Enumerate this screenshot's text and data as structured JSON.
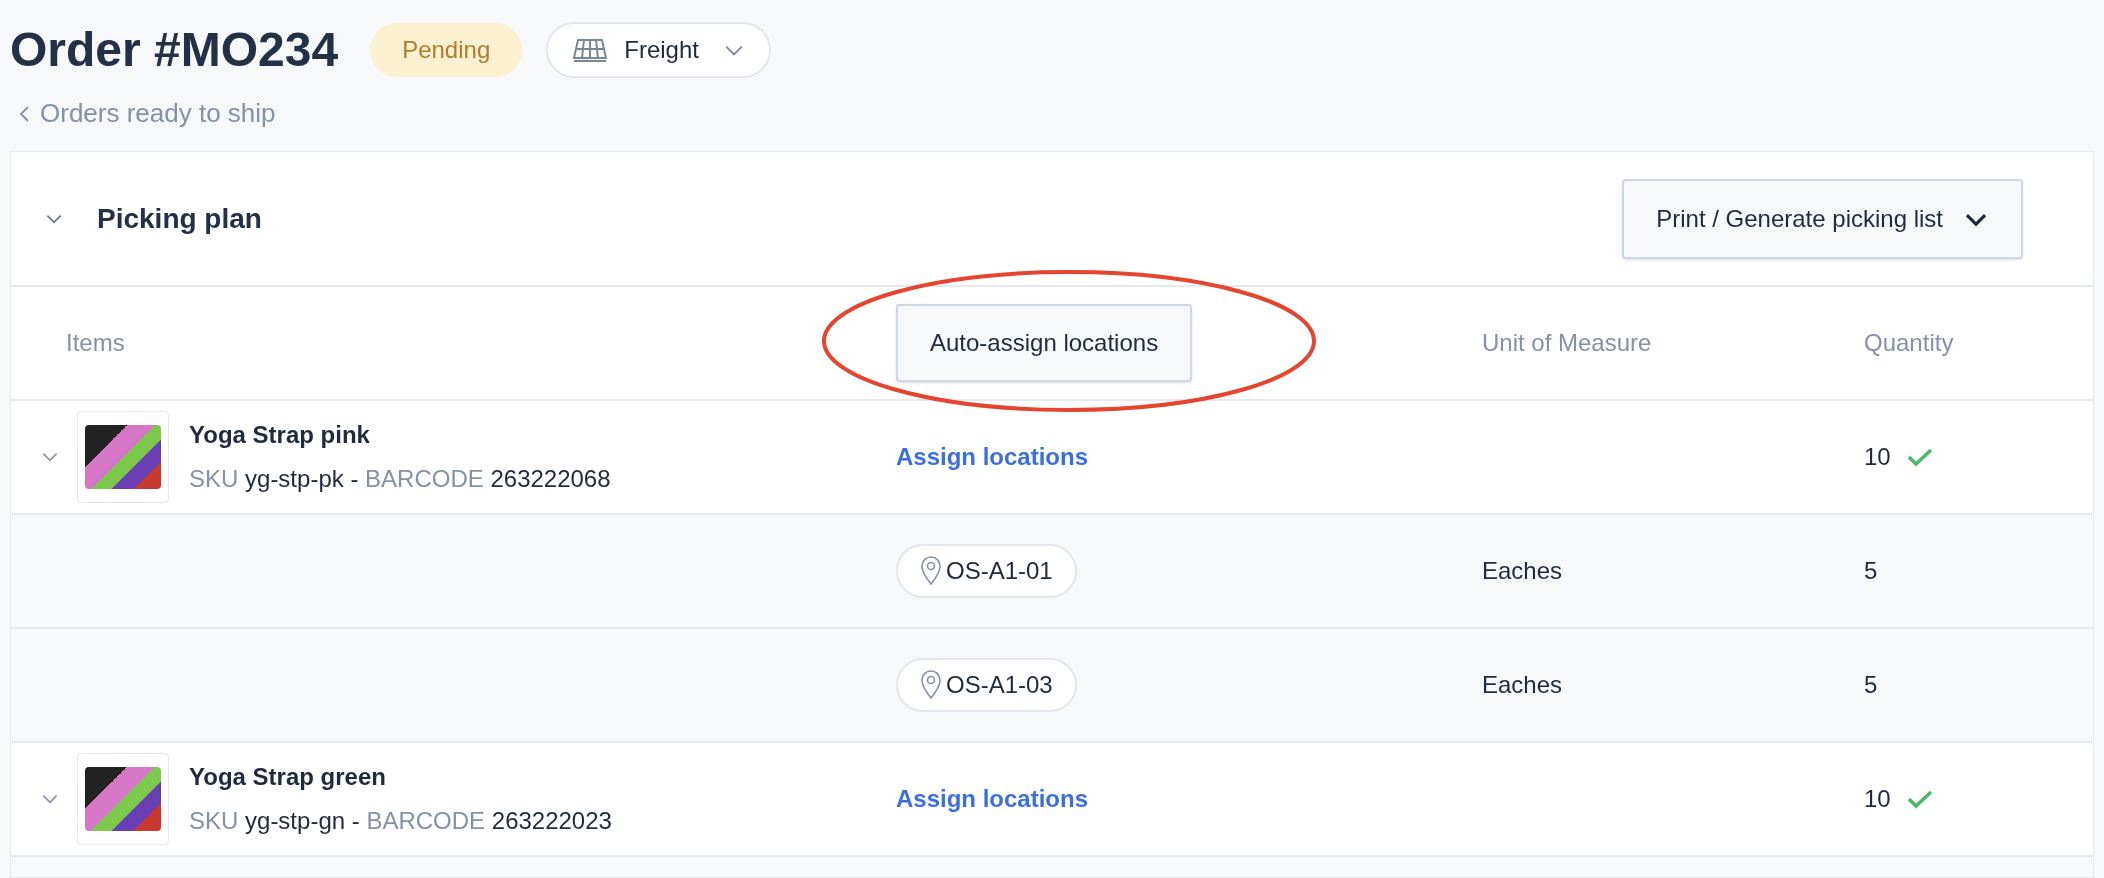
{
  "order": {
    "title": "Order #MO234",
    "status": {
      "label": "Pending",
      "kind": "pending"
    },
    "shipping": {
      "label": "Freight"
    },
    "breadcrumb": "Orders ready to ship"
  },
  "section": {
    "title": "Picking plan",
    "expanded": true,
    "action_button": "Print / Generate picking list"
  },
  "table": {
    "columns": [
      {
        "kind": "text",
        "label": "Items"
      },
      {
        "kind": "button",
        "label": "Auto-assign locations"
      },
      {
        "kind": "text",
        "label": "Unit of Measure"
      },
      {
        "kind": "text",
        "label": "Quantity"
      }
    ],
    "rows": [
      {
        "kind": "product",
        "expanded": true,
        "name": "Yoga Strap pink",
        "sku_label": "SKU",
        "sku": "yg-stp-pk",
        "separator": "-",
        "barcode_label": "BARCODE",
        "barcode": "263222068",
        "link": "Assign locations",
        "quantity": "10",
        "complete": true
      },
      {
        "kind": "location",
        "location": "OS-A1-01",
        "unit": "Eaches",
        "quantity": "5"
      },
      {
        "kind": "location",
        "location": "OS-A1-03",
        "unit": "Eaches",
        "quantity": "5"
      },
      {
        "kind": "product",
        "expanded": true,
        "name": "Yoga Strap green",
        "sku_label": "SKU",
        "sku": "yg-stp-gn",
        "separator": "-",
        "barcode_label": "BARCODE",
        "barcode": "263222023",
        "link": "Assign locations",
        "quantity": "10",
        "complete": true
      }
    ]
  }
}
